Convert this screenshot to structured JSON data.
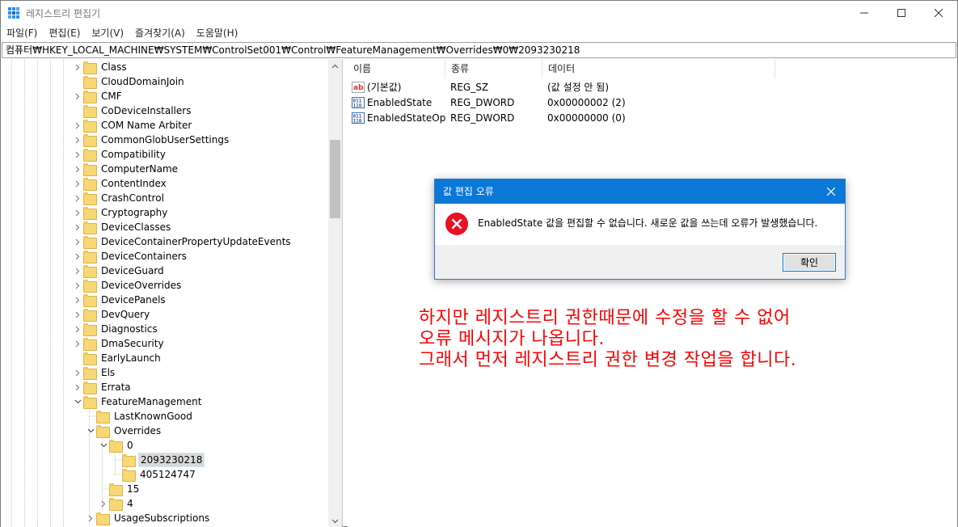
{
  "window": {
    "title": "레지스트리 편집기"
  },
  "menu": [
    "파일(F)",
    "편집(E)",
    "보기(V)",
    "즐겨찾기(A)",
    "도움말(H)"
  ],
  "address": "컴퓨터₩HKEY_LOCAL_MACHINE₩SYSTEM₩ControlSet001₩Control₩FeatureManagement₩Overrides₩0₩2093230218",
  "tree": [
    {
      "label": "Class",
      "arrow": "right"
    },
    {
      "label": "CloudDomainJoin",
      "arrow": "none"
    },
    {
      "label": "CMF",
      "arrow": "right"
    },
    {
      "label": "CoDeviceInstallers",
      "arrow": "none"
    },
    {
      "label": "COM Name Arbiter",
      "arrow": "right"
    },
    {
      "label": "CommonGlobUserSettings",
      "arrow": "right"
    },
    {
      "label": "Compatibility",
      "arrow": "right"
    },
    {
      "label": "ComputerName",
      "arrow": "right"
    },
    {
      "label": "ContentIndex",
      "arrow": "right"
    },
    {
      "label": "CrashControl",
      "arrow": "right"
    },
    {
      "label": "Cryptography",
      "arrow": "right"
    },
    {
      "label": "DeviceClasses",
      "arrow": "right"
    },
    {
      "label": "DeviceContainerPropertyUpdateEvents",
      "arrow": "right"
    },
    {
      "label": "DeviceContainers",
      "arrow": "right"
    },
    {
      "label": "DeviceGuard",
      "arrow": "right"
    },
    {
      "label": "DeviceOverrides",
      "arrow": "right"
    },
    {
      "label": "DevicePanels",
      "arrow": "right"
    },
    {
      "label": "DevQuery",
      "arrow": "right"
    },
    {
      "label": "Diagnostics",
      "arrow": "right"
    },
    {
      "label": "DmaSecurity",
      "arrow": "right"
    },
    {
      "label": "EarlyLaunch",
      "arrow": "none"
    },
    {
      "label": "Els",
      "arrow": "right"
    },
    {
      "label": "Errata",
      "arrow": "right"
    },
    {
      "label": "FeatureManagement",
      "arrow": "down"
    },
    {
      "label": "LastKnownGood",
      "arrow": "none",
      "level": 1
    },
    {
      "label": "Overrides",
      "arrow": "down",
      "level": 1
    },
    {
      "label": "0",
      "arrow": "down",
      "level": 2
    },
    {
      "label": "2093230218",
      "arrow": "none",
      "level": 3,
      "selected": true
    },
    {
      "label": "405124747",
      "arrow": "none",
      "level": 3
    },
    {
      "label": "15",
      "arrow": "none",
      "level": 2
    },
    {
      "label": "4",
      "arrow": "right",
      "level": 2
    },
    {
      "label": "UsageSubscriptions",
      "arrow": "right",
      "level": 1
    }
  ],
  "list": {
    "headers": [
      "이름",
      "종류",
      "데이터"
    ],
    "rows": [
      {
        "name": "(기본값)",
        "type": "REG_SZ",
        "data": "(값 설정 안 됨)",
        "icon": "string-value-icon"
      },
      {
        "name": "EnabledState",
        "type": "REG_DWORD",
        "data": "0x00000002 (2)",
        "icon": "dword-value-icon"
      },
      {
        "name": "EnabledStateOp...",
        "type": "REG_DWORD",
        "data": "0x00000000 (0)",
        "icon": "dword-value-icon"
      }
    ]
  },
  "dialog": {
    "title": "값 편집 오류",
    "message": "EnabledState 값을 편집할 수 없습니다. 새로운 값을 쓰는데 오류가 발생했습니다.",
    "ok_label": "확인"
  },
  "annotation": [
    "하지만 레지스트리 권한때문에 수정을 할 수 없어",
    "오류 메시지가 나옵니다.",
    "그래서 먼저 레지스트리 권한 변경 작업을 합니다."
  ],
  "colors": {
    "dialog_title": "#0a78d7",
    "annotation": "#ff0000",
    "error_icon": "#e81123"
  }
}
